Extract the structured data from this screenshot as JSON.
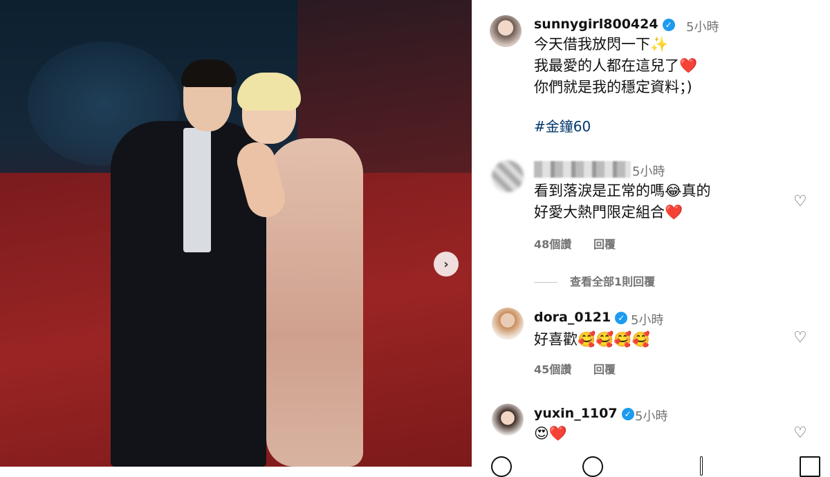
{
  "carousel": {
    "next_icon": "chevron-right-icon"
  },
  "post": {
    "username": "sunnygirl800424",
    "time": "5小時",
    "caption_lines": [
      "今天借我放閃一下✨",
      "我最愛的人都在這兒了❤️",
      "你們就是我的穩定資料；)"
    ],
    "hashtag": "#金鐘60"
  },
  "comments": [
    {
      "username": "",
      "time": "5小時",
      "lines": [
        "看到落淚是正常的嗎😂真的",
        "好愛大熱門限定組合❤️"
      ],
      "likes": "48個讚",
      "reply": "回覆",
      "view_replies": "查看全部1則回覆"
    },
    {
      "username": "dora_0121",
      "time": "5小時",
      "text": "好喜歡🥰🥰🥰🥰",
      "likes": "45個讚",
      "reply": "回覆"
    },
    {
      "username": "yuxin_1107",
      "time": "5小時",
      "text": "😍❤️"
    }
  ],
  "colors": {
    "verified": "#1d9bf0",
    "hashtag": "#00376b",
    "meta": "#737373",
    "carpet": "#8a1f1f"
  }
}
